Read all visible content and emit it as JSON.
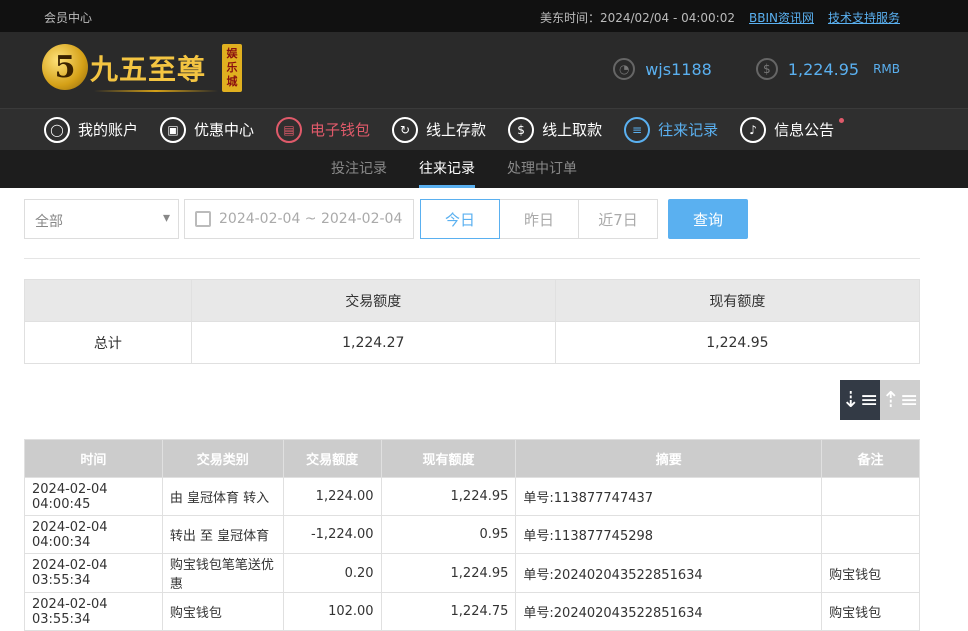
{
  "topbar": {
    "member_center": "会员中心",
    "time_label": "美东时间：2024/02/04 - 04:00:02",
    "links": [
      "BBIN资讯网",
      "技术支持服务"
    ]
  },
  "logo": {
    "coin": "5",
    "brand": "九五至尊",
    "tag": "娱乐城"
  },
  "user": {
    "username": "wjs1188",
    "balance": "1,224.95",
    "unit": "RMB"
  },
  "nav": [
    {
      "label": "我的账户",
      "icon": "user-icon",
      "glyph": "◯"
    },
    {
      "label": "优惠中心",
      "icon": "gift-icon",
      "glyph": "▣"
    },
    {
      "label": "电子钱包",
      "icon": "wallet-icon",
      "glyph": "▤"
    },
    {
      "label": "线上存款",
      "icon": "deposit-icon",
      "glyph": "↻"
    },
    {
      "label": "线上取款",
      "icon": "withdraw-icon",
      "glyph": "$"
    },
    {
      "label": "往来记录",
      "icon": "records-icon",
      "glyph": "≡"
    },
    {
      "label": "信息公告",
      "icon": "bell-icon",
      "glyph": "♪"
    }
  ],
  "subnav": [
    "投注记录",
    "往来记录",
    "处理中订单"
  ],
  "filters": {
    "type_select": "全部",
    "date_range": "2024-02-04 ~ 2024-02-04",
    "quick_buttons": [
      "今日",
      "昨日",
      "近7日"
    ],
    "query_label": "查询"
  },
  "summary": {
    "headers": [
      "",
      "交易额度",
      "现有额度"
    ],
    "row": [
      "总计",
      "1,224.27",
      "1,224.95"
    ]
  },
  "records": {
    "headers": [
      "时间",
      "交易类别",
      "交易额度",
      "现有额度",
      "摘要",
      "备注"
    ],
    "rows": [
      [
        "2024-02-04 04:00:45",
        "由 皇冠体育 转入",
        "1,224.00",
        "1,224.95",
        "单号:113877747437",
        ""
      ],
      [
        "2024-02-04 04:00:34",
        "转出 至 皇冠体育",
        "-1,224.00",
        "0.95",
        "单号:113877745298",
        ""
      ],
      [
        "2024-02-04 03:55:34",
        "购宝钱包笔笔送优惠",
        "0.20",
        "1,224.95",
        "单号:202402043522851634",
        "购宝钱包"
      ],
      [
        "2024-02-04 03:55:34",
        "购宝钱包",
        "102.00",
        "1,224.75",
        "单号:202402043522851634",
        "购宝钱包"
      ]
    ]
  },
  "colors": {
    "accent": "#5ab0f0",
    "wallet": "#e05a6a",
    "gold": "#f4c542"
  }
}
